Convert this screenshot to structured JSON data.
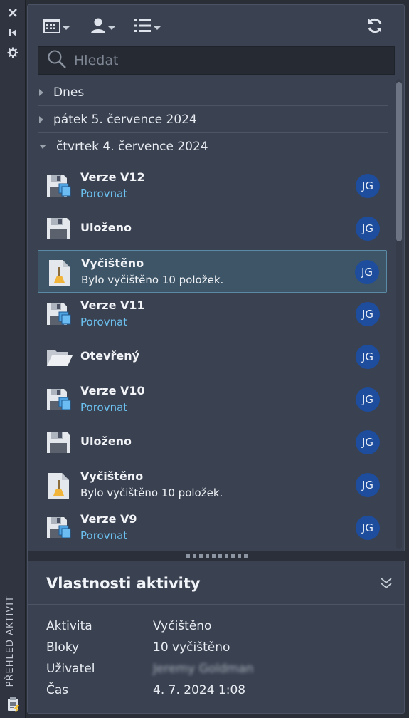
{
  "sidebar": {
    "close_icon": "close-icon",
    "pin_icon": "collapse-icon",
    "settings_icon": "gear-icon",
    "title": "PŘEHLED AKTIVIT"
  },
  "toolbar": {
    "filter_date_icon": "calendar-icon",
    "filter_user_icon": "user-icon",
    "filter_type_icon": "list-icon",
    "refresh_icon": "refresh-icon"
  },
  "search": {
    "placeholder": "Hledat"
  },
  "groups": [
    {
      "label": "Dnes",
      "expanded": false
    },
    {
      "label": "pátek 5. července 2024",
      "expanded": false
    },
    {
      "label": "čtvrtek 4. července 2024",
      "expanded": true
    }
  ],
  "items": [
    {
      "icon": "version-save-icon",
      "title": "Verze V12",
      "sub": "Porovnat",
      "sub_link": true,
      "user": "JG"
    },
    {
      "icon": "save-icon",
      "title": "Uloženo",
      "sub": "",
      "sub_link": false,
      "user": "JG"
    },
    {
      "icon": "purge-icon",
      "title": "Vyčištěno",
      "sub": "Bylo vyčištěno 10 položek.",
      "sub_link": false,
      "user": "JG",
      "selected": true
    },
    {
      "icon": "version-save-icon",
      "title": "Verze V11",
      "sub": "Porovnat",
      "sub_link": true,
      "user": "JG"
    },
    {
      "icon": "folder-open-icon",
      "title": "Otevřený",
      "sub": "",
      "sub_link": false,
      "user": "JG"
    },
    {
      "icon": "version-save-icon",
      "title": "Verze V10",
      "sub": "Porovnat",
      "sub_link": true,
      "user": "JG"
    },
    {
      "icon": "save-icon",
      "title": "Uloženo",
      "sub": "",
      "sub_link": false,
      "user": "JG"
    },
    {
      "icon": "purge-icon",
      "title": "Vyčištěno",
      "sub": "Bylo vyčištěno 10 položek.",
      "sub_link": false,
      "user": "JG"
    },
    {
      "icon": "version-save-icon",
      "title": "Verze V9",
      "sub": "Porovnat",
      "sub_link": true,
      "user": "JG"
    }
  ],
  "properties": {
    "title": "Vlastnosti aktivity",
    "rows": [
      {
        "label": "Aktivita",
        "value": "Vyčištěno"
      },
      {
        "label": "Bloky",
        "value": "10 vyčištěno"
      },
      {
        "label": "Uživatel",
        "value": "Jeremy Goldman",
        "blurred": true
      },
      {
        "label": "Čas",
        "value": "4. 7. 2024 1:08"
      }
    ]
  },
  "colors": {
    "panel_bg": "#3a4150",
    "link": "#6cc1f0",
    "avatar": "#1d4d9c",
    "selected_bg": "#3d5566",
    "selected_border": "#5b8aa6"
  }
}
